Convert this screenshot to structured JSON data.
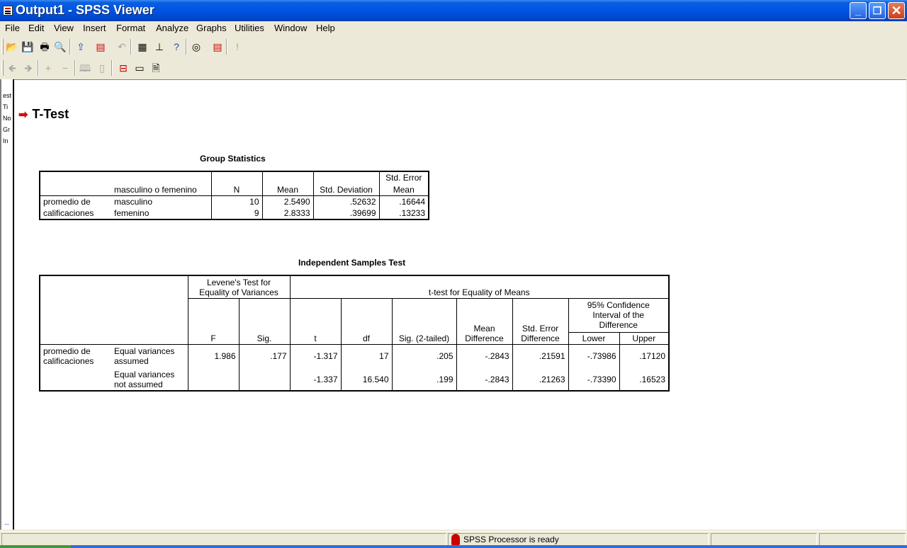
{
  "window": {
    "title": "Output1 - SPSS Viewer",
    "minimize": "_",
    "maximize": "❐",
    "close": "✕"
  },
  "menu": [
    "File",
    "Edit",
    "View",
    "Insert",
    "Format",
    "Analyze",
    "Graphs",
    "Utilities",
    "Window",
    "Help"
  ],
  "toolbar1": [
    "open-icon",
    "save-icon",
    "print-icon",
    "print-preview-icon",
    "export-icon",
    "dialog-recall-icon",
    "undo-icon",
    "goto-data-icon",
    "goto-case-icon",
    "variables-icon",
    "find-icon",
    "select-cases-icon",
    "run-icon"
  ],
  "toolbar2": [
    "promote-icon",
    "demote-icon",
    "expand-icon",
    "collapse-icon",
    "show-icon",
    "hide-icon",
    "insert-heading-icon",
    "insert-title-icon",
    "insert-text-icon"
  ],
  "outline": [
    "est",
    "Ti",
    "No",
    "Gr",
    "In"
  ],
  "heading": "T-Test",
  "group_stats": {
    "caption": "Group Statistics",
    "headers": {
      "group": "masculino o femenino",
      "n": "N",
      "mean": "Mean",
      "sd": "Std. Deviation",
      "se1": "Std. Error",
      "se2": "Mean"
    },
    "row_label1": "promedio de",
    "row_label2": "calificaciones",
    "rows": [
      {
        "group": "masculino",
        "n": "10",
        "mean": "2.5490",
        "sd": ".52632",
        "se": ".16644"
      },
      {
        "group": "femenino",
        "n": "9",
        "mean": "2.8333",
        "sd": ".39699",
        "se": ".13233"
      }
    ]
  },
  "ind_test": {
    "caption": "Independent Samples Test",
    "levene1": "Levene's Test for",
    "levene2": "Equality of Variances",
    "ttest": "t-test for Equality of Means",
    "ci1": "95% Confidence",
    "ci2": "Interval of the",
    "ci3": "Difference",
    "headers": {
      "f": "F",
      "sig": "Sig.",
      "t": "t",
      "df": "df",
      "sig2": "Sig. (2-tailed)",
      "md1": "Mean",
      "md2": "Difference",
      "se1": "Std. Error",
      "se2": "Difference",
      "lower": "Lower",
      "upper": "Upper"
    },
    "row_label1": "promedio de",
    "row_label2": "calificaciones",
    "rows": [
      {
        "a1": "Equal variances",
        "a2": "assumed",
        "f": "1.986",
        "sig": ".177",
        "t": "-1.317",
        "df": "17",
        "sig2": ".205",
        "md": "-.2843",
        "se": ".21591",
        "lower": "-.73986",
        "upper": ".17120"
      },
      {
        "a1": "Equal variances",
        "a2": "not assumed",
        "f": "",
        "sig": "",
        "t": "-1.337",
        "df": "16.540",
        "sig2": ".199",
        "md": "-.2843",
        "se": ".21263",
        "lower": "-.73390",
        "upper": ".16523"
      }
    ]
  },
  "status": {
    "text": "SPSS Processor  is ready"
  }
}
